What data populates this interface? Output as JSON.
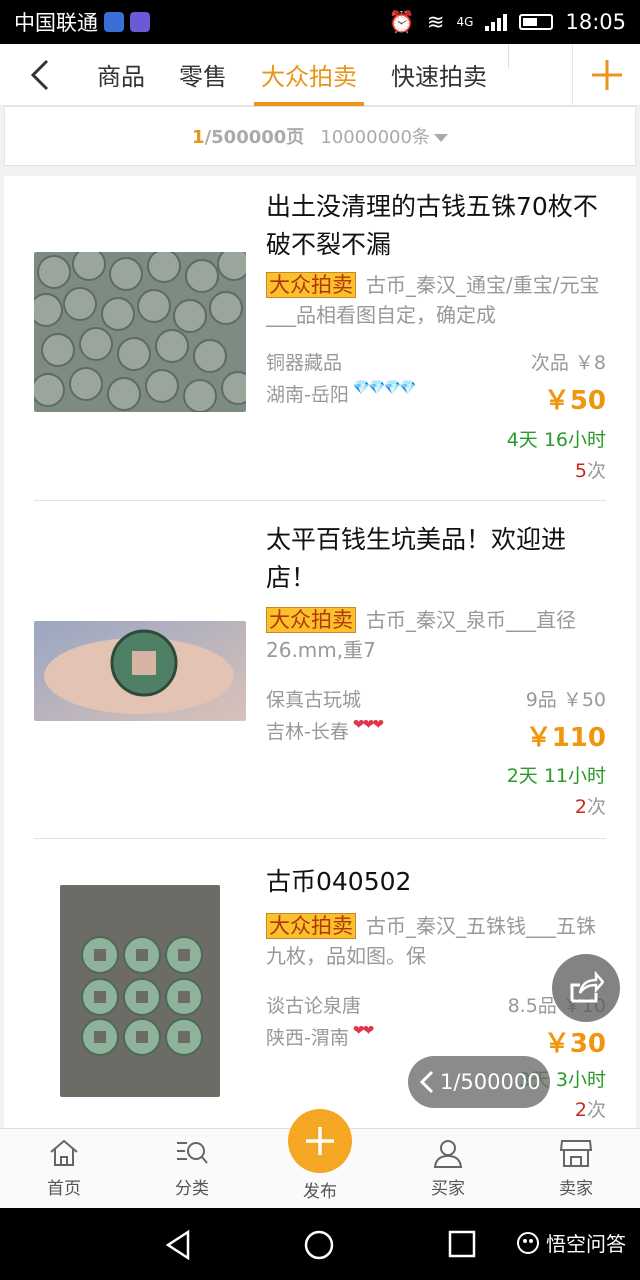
{
  "status": {
    "carrier": "中国联通",
    "network": "4G",
    "time": "18:05"
  },
  "nav": {
    "tabs": [
      "商品",
      "零售",
      "大众拍卖",
      "快速拍卖"
    ],
    "active_tab": "大众拍卖"
  },
  "pager": {
    "current": "1",
    "pages": "/500000页",
    "count": "10000000条"
  },
  "items": [
    {
      "title": "出土没清理的古钱五铢70枚不破不裂不漏",
      "tag": "大众拍卖",
      "desc": "古币_秦汉_通宝/重宝/元宝___品相看图自定，确定成",
      "shop": "铜器藏品",
      "grade_start": "次品  ￥8",
      "location": "湖南-岳阳",
      "gems": "💎💎💎💎",
      "price": "￥50",
      "time": "4天 16小时",
      "bids_num": "5",
      "bids_unit": "次"
    },
    {
      "title": "太平百钱生坑美品！欢迎进店！",
      "tag": "大众拍卖",
      "desc": "古币_秦汉_泉币___直径26.mm,重7",
      "shop": "保真古玩城",
      "grade_start": "9品  ￥50",
      "location": "吉林-长春",
      "gems": "❤❤❤",
      "price": "￥110",
      "time": "2天 11小时",
      "bids_num": "2",
      "bids_unit": "次"
    },
    {
      "title": "古币040502",
      "tag": "大众拍卖",
      "desc": "古币_秦汉_五铢钱___五铢九枚，品如图。保",
      "shop": "谈古论泉唐",
      "grade_start": "8.5品  ￥10",
      "location": "陕西-渭南",
      "gems": "❤❤",
      "price": "￥30",
      "time": "3天 3小时",
      "bids_num": "2",
      "bids_unit": "次"
    }
  ],
  "page_pill": "1/500000",
  "tabbar": [
    "首页",
    "分类",
    "发布",
    "买家",
    "卖家"
  ],
  "watermark": "悟空问答",
  "colors": {
    "accent": "#e8961a",
    "price": "#f0960e",
    "time_green": "#2a9a2a",
    "tag_bg": "#fbc12c"
  }
}
